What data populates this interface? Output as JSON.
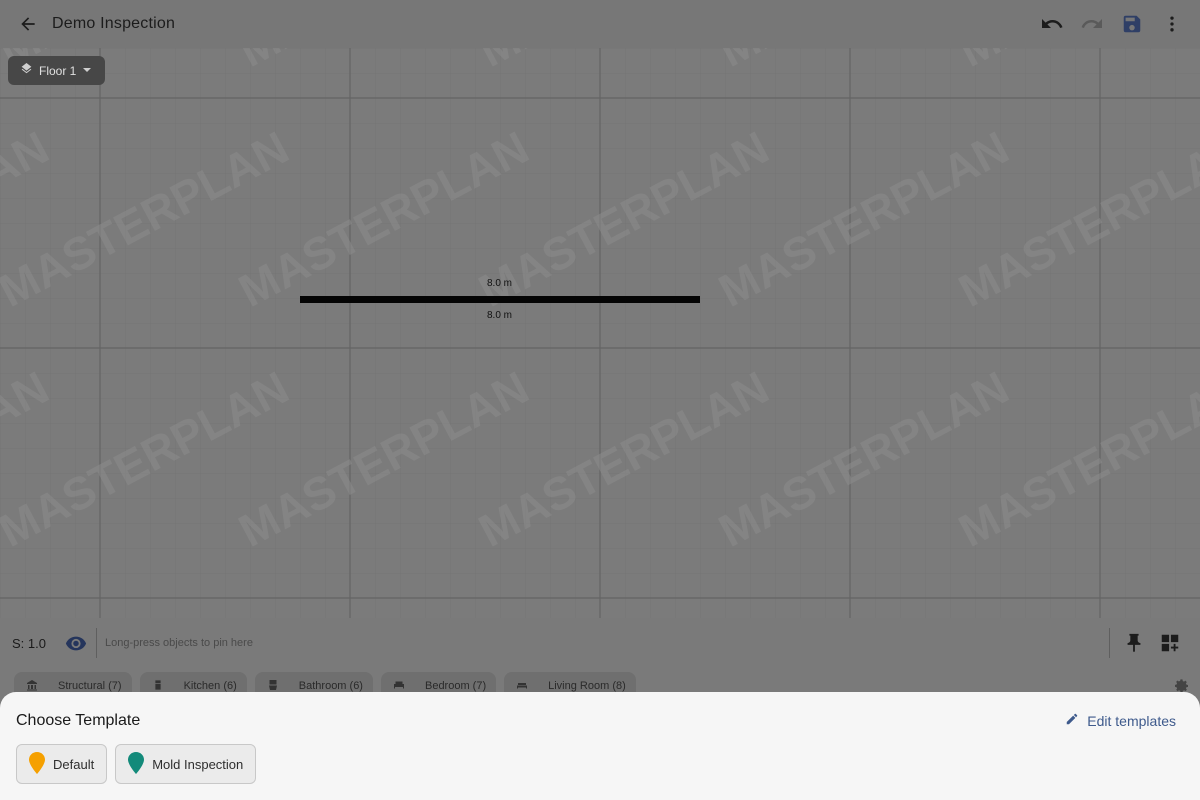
{
  "app": {
    "title": "Demo Inspection"
  },
  "icons": {
    "back": "arrow-left-icon",
    "undo": "undo-icon",
    "redo": "redo-icon",
    "save": "save-icon",
    "more": "more-vert-icon",
    "layers": "layers-icon",
    "eye": "eye-icon",
    "pin": "pin-icon",
    "add_grid": "grid-add-icon",
    "settings": "gear-icon",
    "edit": "pencil-icon"
  },
  "colors": {
    "save_icon": "#2f3f66",
    "accent_link": "#3e5a8c",
    "marker_default": "#f5a000",
    "marker_mold": "#138a7a"
  },
  "floor_selector": {
    "label": "Floor 1"
  },
  "canvas": {
    "watermark": "MASTERPLAN",
    "wall": {
      "top_label": "8.0 m",
      "bottom_label": "8.0 m"
    }
  },
  "toolbar": {
    "scale_label": "S: 1.0",
    "pin_hint": "Long-press objects to pin here"
  },
  "categories": [
    {
      "label": "Structural (7)",
      "icon": "structure-icon"
    },
    {
      "label": "Kitchen (6)",
      "icon": "fridge-icon"
    },
    {
      "label": "Bathroom (6)",
      "icon": "toilet-icon"
    },
    {
      "label": "Bedroom (7)",
      "icon": "bed-icon"
    },
    {
      "label": "Living Room (8)",
      "icon": "sofa-icon"
    }
  ],
  "sheet": {
    "title": "Choose Template",
    "edit_label": "Edit templates",
    "templates": [
      {
        "label": "Default",
        "marker_color": "#f5a000"
      },
      {
        "label": "Mold Inspection",
        "marker_color": "#138a7a"
      }
    ]
  }
}
